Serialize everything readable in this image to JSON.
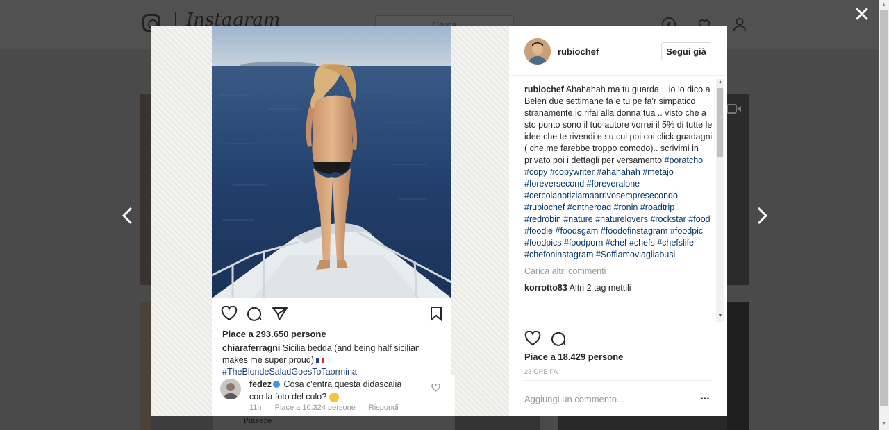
{
  "background": {
    "logo_text": "Instagram",
    "search_placeholder": "Cerca",
    "thumb_caption": "Piasere"
  },
  "overlay": {
    "close_icon": "close-icon",
    "prev_icon": "chevron-left-icon",
    "next_icon": "chevron-right-icon"
  },
  "post_screenshot": {
    "likes": "Piace a 293.650 persone",
    "caption_user": "chiaraferragni",
    "caption_text": " Sicilia bedda (and being half sicilian makes me super proud) ",
    "caption_hashtag": "#TheBlondeSaladGoesToTaormina",
    "comment": {
      "user": "fedez",
      "text": " Cosa c'entra questa didascalia con la foto del culo? ",
      "time": "11h",
      "likes": "Piace a 10.324 persone",
      "reply": "Rispondi"
    }
  },
  "sidebar": {
    "username": "rubiochef",
    "follow_label": "Segui già",
    "comment": {
      "user": "rubiochef",
      "text": " Ahahahah ma tu guarda .. io lo dico a Belen due settimane fa e tu pe fa'r simpatico stranamente lo rifai alla donna tua .. visto che a sto punto sono il tuo autore vorrei il 5% di tutte le idee che te rivendi e su cui poi coi click guadagni ( che me farebbe troppo comodo).. scrivimi in privato poi i dettagli per versamento ",
      "hashtags": [
        "#poratcho",
        "#copy",
        "#copywriter",
        "#ahahahah",
        "#metajo",
        "#foreversecond",
        "#foreveralone",
        "#cercolanotiziamaarrivosempresecondo",
        "#rubiochef",
        "#ontheroad",
        "#ronin",
        "#roadtrip",
        "#redrobin",
        "#nature",
        "#naturelovers",
        "#rockstar",
        "#food",
        "#foodie",
        "#foodsgam",
        "#foodofinstagram",
        "#foodpic",
        "#foodpics",
        "#foodporn",
        "#chef",
        "#chefs",
        "#chefslife",
        "#chefoninstagram",
        "#Soffiamoviagliabusi"
      ]
    },
    "load_more": "Carica altri commenti",
    "second_comment": {
      "user": "korrotto83",
      "text": " Altri 2 tag mettili"
    },
    "likes": "Piace a 18.429 persone",
    "time": "23 ORE FA",
    "add_comment_placeholder": "Aggiungi un commento...",
    "more_label": "..."
  }
}
